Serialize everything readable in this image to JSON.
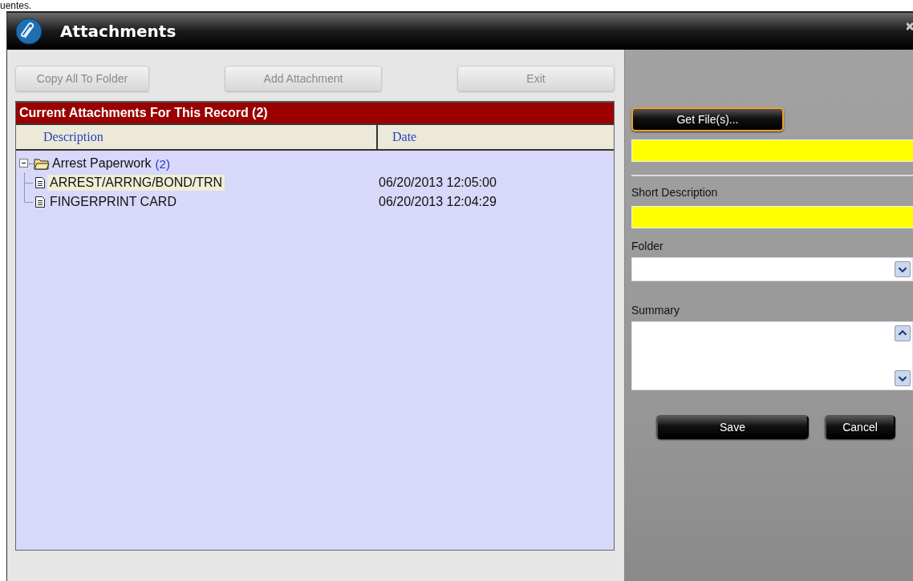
{
  "cut_text": "uentes.",
  "window": {
    "title": "Attachments"
  },
  "toolbar": {
    "buttons": [
      {
        "label": "Copy All To Folder",
        "disabled": true
      },
      {
        "label": "Add Attachment",
        "disabled": true
      },
      {
        "label": "Exit",
        "disabled": true
      }
    ]
  },
  "attachments": {
    "title": "Current Attachments For This Record (2)",
    "columns": [
      "Description",
      "Date"
    ],
    "tree": [
      {
        "label": "Arrest Paperwork",
        "count": "(2)",
        "expanded": true,
        "children": [
          {
            "label": "ARREST/ARRNG/BOND/TRN",
            "date": "06/20/2013 12:05:00",
            "selected": true
          },
          {
            "label": "FINGERPRINT CARD",
            "date": "06/20/2013 12:04:29",
            "selected": false
          }
        ]
      }
    ]
  },
  "details": {
    "get_files_button": "Get File(s)...",
    "file_field": {
      "required": true
    },
    "short_description": {
      "label": "Short Description",
      "required": true
    },
    "folder": {
      "label": "Folder"
    },
    "summary": {
      "label": "Summary"
    },
    "buttons": [
      "Save",
      "Cancel"
    ]
  }
}
